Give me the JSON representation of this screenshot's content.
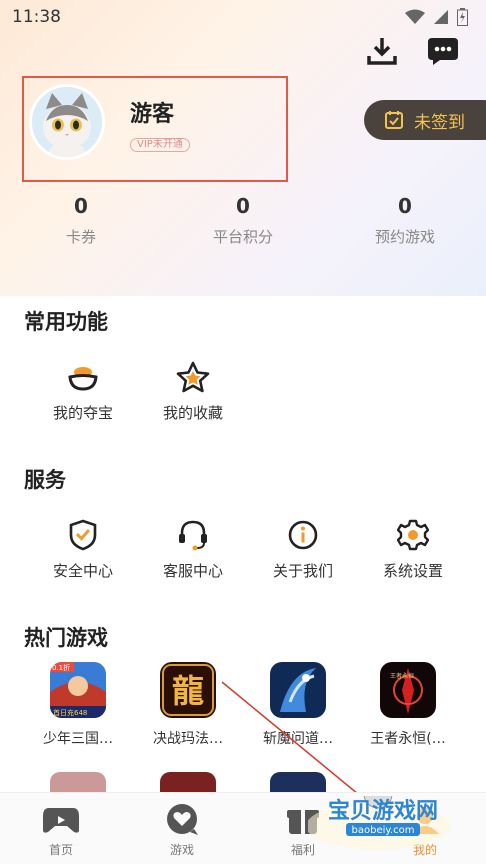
{
  "status": {
    "time": "11:38"
  },
  "profile": {
    "name": "游客",
    "vip": "VIP未开通"
  },
  "checkin": {
    "label": "未签到"
  },
  "stats": [
    {
      "value": "0",
      "label": "卡券"
    },
    {
      "value": "0",
      "label": "平台积分"
    },
    {
      "value": "0",
      "label": "预约游戏"
    }
  ],
  "sections": {
    "common": "常用功能",
    "service": "服务",
    "hot_games": "热门游戏"
  },
  "common_items": [
    {
      "label": "我的夺宝",
      "icon": "treasure-icon"
    },
    {
      "label": "我的收藏",
      "icon": "star-icon"
    }
  ],
  "service_items": [
    {
      "label": "安全中心",
      "icon": "shield-check-icon"
    },
    {
      "label": "客服中心",
      "icon": "headset-icon"
    },
    {
      "label": "关于我们",
      "icon": "info-icon"
    },
    {
      "label": "系统设置",
      "icon": "gear-icon"
    }
  ],
  "games": [
    {
      "label": "少年三国…",
      "tag": "0.1折",
      "banner": "首日充648"
    },
    {
      "label": "决战玛法…",
      "glyph": "龍"
    },
    {
      "label": "斩魔问道…"
    },
    {
      "label": "王者永恒(…",
      "tag": "王者永恒"
    }
  ],
  "tabs": [
    {
      "label": "首页",
      "icon": "gamepad-home-icon"
    },
    {
      "label": "游戏",
      "icon": "heart-chat-icon"
    },
    {
      "label": "福利",
      "icon": "gift-icon"
    },
    {
      "label": "我的",
      "icon": "profile-icon"
    }
  ],
  "watermark": {
    "title": "宝贝游戏网",
    "url": "baobeiy.com"
  },
  "colors": {
    "accent": "#f39a2b",
    "checkin_bg": "#4a433d",
    "checkin_text": "#f3c24f",
    "highlight_border": "#e05a4a"
  }
}
